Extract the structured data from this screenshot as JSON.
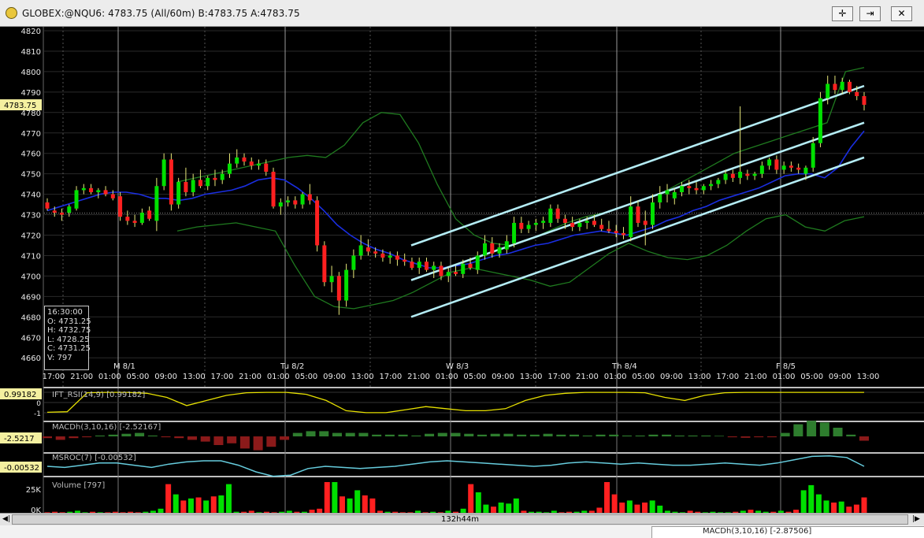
{
  "window": {
    "title": "GLOBEX:@NQU6: 4783.75 (All/60m)  B:4783.75  A:4783.75",
    "buttons": [
      {
        "name": "crosshair-button",
        "glyph": "✛"
      },
      {
        "name": "pin-button",
        "glyph": "⇥"
      },
      {
        "name": "close-button",
        "glyph": "✕"
      }
    ]
  },
  "price_axis": {
    "ticks": [
      "4820",
      "4810",
      "4800",
      "4790",
      "4780",
      "4770",
      "4760",
      "4750",
      "4740",
      "4730",
      "4720",
      "4710",
      "4700",
      "4690",
      "4680",
      "4670",
      "4660"
    ],
    "current_price_tag": "4783.75"
  },
  "time_axis": {
    "day_labels": [
      "M  8/1",
      "Tu 8/2",
      "W  8/3",
      "Th 8/4",
      "F  8/5"
    ],
    "hour_labels": [
      "17:00",
      "21:00",
      "01:00",
      "05:00",
      "09:00",
      "13:00",
      "17:00",
      "21:00",
      "01:00",
      "05:00",
      "09:00",
      "13:00",
      "17:00",
      "21:00",
      "01:00",
      "05:00",
      "09:00",
      "13:00",
      "17:00",
      "21:00",
      "01:00",
      "05:00",
      "09:00",
      "13:00",
      "17:00",
      "21:00",
      "01:00",
      "05:00",
      "09:00",
      "13:00"
    ]
  },
  "ohlc_box": {
    "time": "16:30:00",
    "open": "O: 4731.25",
    "high": "H: 4732.75",
    "low": "L: 4728.25",
    "close": "C: 4731.25",
    "vol": "V: 797"
  },
  "indicators": {
    "ift_rsi": {
      "label": "IFT_RSI(14,9)  [0.99182]",
      "tag": "0.99182",
      "ticks": [
        "1",
        "0",
        "-1"
      ],
      "color": "#e6e000"
    },
    "macdh": {
      "label": "MACDh(3,10,16)  [-2.52167]",
      "tag": "-2.5217",
      "color": "#2e8b2e"
    },
    "msroc": {
      "label": "MSROC(7)  [-0.00532]",
      "tag": "-0.00532",
      "color": "#66ccdd"
    },
    "volume": {
      "label": "Volume  [797]",
      "ticks": [
        "25K",
        "0K"
      ]
    }
  },
  "scrollbar": {
    "label": "132h44m"
  },
  "statusbar": {
    "text": "MACDh(3,10,16)  [-2.87506]"
  },
  "colors": {
    "background": "#000000",
    "up_candle": "#00e000",
    "down_candle": "#ff2020",
    "wick": "#e8e87a",
    "bollinger": "#1f7a1f",
    "moving_average": "#1a2ee0",
    "channel": "#b4ecf4"
  },
  "chart_data": {
    "type": "candlestick",
    "instrument": "@NQU6",
    "interval": "60m",
    "ylim": [
      4655,
      4822
    ],
    "candles": [
      {
        "o": 4736,
        "h": 4738,
        "l": 4732,
        "c": 4733
      },
      {
        "o": 4732,
        "h": 4734,
        "l": 4729,
        "c": 4731
      },
      {
        "o": 4731,
        "h": 4733,
        "l": 4727,
        "c": 4730
      },
      {
        "o": 4731,
        "h": 4735,
        "l": 4729,
        "c": 4734
      },
      {
        "o": 4733,
        "h": 4744,
        "l": 4732,
        "c": 4742
      },
      {
        "o": 4742,
        "h": 4745,
        "l": 4740,
        "c": 4743
      },
      {
        "o": 4743,
        "h": 4745,
        "l": 4740,
        "c": 4741
      },
      {
        "o": 4741,
        "h": 4743,
        "l": 4738,
        "c": 4742
      },
      {
        "o": 4742,
        "h": 4744,
        "l": 4739,
        "c": 4740
      },
      {
        "o": 4740,
        "h": 4742,
        "l": 4737,
        "c": 4738
      },
      {
        "o": 4739,
        "h": 4741,
        "l": 4727,
        "c": 4729
      },
      {
        "o": 4729,
        "h": 4732,
        "l": 4725,
        "c": 4727
      },
      {
        "o": 4727,
        "h": 4730,
        "l": 4724,
        "c": 4726
      },
      {
        "o": 4726,
        "h": 4733,
        "l": 4725,
        "c": 4731
      },
      {
        "o": 4732,
        "h": 4734,
        "l": 4727,
        "c": 4728
      },
      {
        "o": 4727,
        "h": 4748,
        "l": 4722,
        "c": 4744
      },
      {
        "o": 4744,
        "h": 4760,
        "l": 4742,
        "c": 4757
      },
      {
        "o": 4757,
        "h": 4760,
        "l": 4732,
        "c": 4735
      },
      {
        "o": 4735,
        "h": 4748,
        "l": 4733,
        "c": 4746
      },
      {
        "o": 4746,
        "h": 4753,
        "l": 4739,
        "c": 4741
      },
      {
        "o": 4741,
        "h": 4750,
        "l": 4739,
        "c": 4747
      },
      {
        "o": 4747,
        "h": 4752,
        "l": 4743,
        "c": 4744
      },
      {
        "o": 4744,
        "h": 4749,
        "l": 4742,
        "c": 4748
      },
      {
        "o": 4748,
        "h": 4752,
        "l": 4744,
        "c": 4747
      },
      {
        "o": 4747,
        "h": 4752,
        "l": 4745,
        "c": 4750
      },
      {
        "o": 4750,
        "h": 4760,
        "l": 4748,
        "c": 4755
      },
      {
        "o": 4755,
        "h": 4762,
        "l": 4753,
        "c": 4758
      },
      {
        "o": 4758,
        "h": 4760,
        "l": 4754,
        "c": 4756
      },
      {
        "o": 4756,
        "h": 4758,
        "l": 4752,
        "c": 4754
      },
      {
        "o": 4754,
        "h": 4757,
        "l": 4752,
        "c": 4755
      },
      {
        "o": 4755,
        "h": 4757,
        "l": 4749,
        "c": 4751
      },
      {
        "o": 4751,
        "h": 4753,
        "l": 4733,
        "c": 4734
      },
      {
        "o": 4734,
        "h": 4738,
        "l": 4730,
        "c": 4736
      },
      {
        "o": 4736,
        "h": 4739,
        "l": 4734,
        "c": 4737
      },
      {
        "o": 4737,
        "h": 4739,
        "l": 4733,
        "c": 4735
      },
      {
        "o": 4735,
        "h": 4741,
        "l": 4733,
        "c": 4740
      },
      {
        "o": 4740,
        "h": 4745,
        "l": 4735,
        "c": 4737
      },
      {
        "o": 4737,
        "h": 4739,
        "l": 4712,
        "c": 4715
      },
      {
        "o": 4715,
        "h": 4717,
        "l": 4695,
        "c": 4697
      },
      {
        "o": 4697,
        "h": 4705,
        "l": 4692,
        "c": 4700
      },
      {
        "o": 4700,
        "h": 4702,
        "l": 4681,
        "c": 4688
      },
      {
        "o": 4688,
        "h": 4706,
        "l": 4685,
        "c": 4703
      },
      {
        "o": 4703,
        "h": 4713,
        "l": 4699,
        "c": 4710
      },
      {
        "o": 4710,
        "h": 4720,
        "l": 4708,
        "c": 4715
      },
      {
        "o": 4714,
        "h": 4718,
        "l": 4710,
        "c": 4712
      },
      {
        "o": 4712,
        "h": 4714,
        "l": 4709,
        "c": 4711
      },
      {
        "o": 4711,
        "h": 4713,
        "l": 4707,
        "c": 4709
      },
      {
        "o": 4709,
        "h": 4712,
        "l": 4706,
        "c": 4710
      },
      {
        "o": 4710,
        "h": 4712,
        "l": 4705,
        "c": 4708
      },
      {
        "o": 4708,
        "h": 4711,
        "l": 4705,
        "c": 4707
      },
      {
        "o": 4707,
        "h": 4709,
        "l": 4703,
        "c": 4704
      },
      {
        "o": 4704,
        "h": 4709,
        "l": 4701,
        "c": 4707
      },
      {
        "o": 4707,
        "h": 4709,
        "l": 4702,
        "c": 4703
      },
      {
        "o": 4703,
        "h": 4707,
        "l": 4699,
        "c": 4705
      },
      {
        "o": 4705,
        "h": 4707,
        "l": 4698,
        "c": 4700
      },
      {
        "o": 4700,
        "h": 4704,
        "l": 4697,
        "c": 4702
      },
      {
        "o": 4702,
        "h": 4705,
        "l": 4700,
        "c": 4701
      },
      {
        "o": 4701,
        "h": 4708,
        "l": 4699,
        "c": 4706
      },
      {
        "o": 4706,
        "h": 4709,
        "l": 4703,
        "c": 4704
      },
      {
        "o": 4703,
        "h": 4712,
        "l": 4701,
        "c": 4710
      },
      {
        "o": 4710,
        "h": 4720,
        "l": 4708,
        "c": 4716
      },
      {
        "o": 4716,
        "h": 4719,
        "l": 4709,
        "c": 4711
      },
      {
        "o": 4711,
        "h": 4716,
        "l": 4709,
        "c": 4714
      },
      {
        "o": 4713,
        "h": 4720,
        "l": 4711,
        "c": 4717
      },
      {
        "o": 4716,
        "h": 4729,
        "l": 4714,
        "c": 4726
      },
      {
        "o": 4726,
        "h": 4729,
        "l": 4721,
        "c": 4723
      },
      {
        "o": 4723,
        "h": 4727,
        "l": 4721,
        "c": 4725
      },
      {
        "o": 4725,
        "h": 4728,
        "l": 4722,
        "c": 4726
      },
      {
        "o": 4726,
        "h": 4729,
        "l": 4723,
        "c": 4727
      },
      {
        "o": 4726,
        "h": 4735,
        "l": 4724,
        "c": 4733
      },
      {
        "o": 4733,
        "h": 4735,
        "l": 4726,
        "c": 4728
      },
      {
        "o": 4728,
        "h": 4730,
        "l": 4723,
        "c": 4726
      },
      {
        "o": 4726,
        "h": 4729,
        "l": 4722,
        "c": 4724
      },
      {
        "o": 4724,
        "h": 4728,
        "l": 4722,
        "c": 4726
      },
      {
        "o": 4726,
        "h": 4729,
        "l": 4723,
        "c": 4727
      },
      {
        "o": 4727,
        "h": 4730,
        "l": 4724,
        "c": 4725
      },
      {
        "o": 4725,
        "h": 4728,
        "l": 4722,
        "c": 4723
      },
      {
        "o": 4723,
        "h": 4727,
        "l": 4721,
        "c": 4722
      },
      {
        "o": 4722,
        "h": 4725,
        "l": 4719,
        "c": 4721
      },
      {
        "o": 4721,
        "h": 4724,
        "l": 4718,
        "c": 4720
      },
      {
        "o": 4719,
        "h": 4739,
        "l": 4717,
        "c": 4734
      },
      {
        "o": 4734,
        "h": 4737,
        "l": 4724,
        "c": 4726
      },
      {
        "o": 4727,
        "h": 4732,
        "l": 4715,
        "c": 4725
      },
      {
        "o": 4725,
        "h": 4740,
        "l": 4723,
        "c": 4736
      },
      {
        "o": 4736,
        "h": 4744,
        "l": 4733,
        "c": 4740
      },
      {
        "o": 4740,
        "h": 4745,
        "l": 4736,
        "c": 4742
      },
      {
        "o": 4738,
        "h": 4743,
        "l": 4735,
        "c": 4741
      },
      {
        "o": 4741,
        "h": 4746,
        "l": 4739,
        "c": 4744
      },
      {
        "o": 4744,
        "h": 4747,
        "l": 4740,
        "c": 4743
      },
      {
        "o": 4743,
        "h": 4746,
        "l": 4740,
        "c": 4742
      },
      {
        "o": 4742,
        "h": 4745,
        "l": 4740,
        "c": 4744
      },
      {
        "o": 4744,
        "h": 4747,
        "l": 4742,
        "c": 4745
      },
      {
        "o": 4745,
        "h": 4748,
        "l": 4743,
        "c": 4747
      },
      {
        "o": 4747,
        "h": 4752,
        "l": 4745,
        "c": 4750
      },
      {
        "o": 4750,
        "h": 4752,
        "l": 4746,
        "c": 4748
      },
      {
        "o": 4748,
        "h": 4783,
        "l": 4745,
        "c": 4751
      },
      {
        "o": 4750,
        "h": 4752,
        "l": 4747,
        "c": 4749
      },
      {
        "o": 4749,
        "h": 4751,
        "l": 4747,
        "c": 4750
      },
      {
        "o": 4750,
        "h": 4756,
        "l": 4748,
        "c": 4754
      },
      {
        "o": 4754,
        "h": 4758,
        "l": 4752,
        "c": 4757
      },
      {
        "o": 4757,
        "h": 4759,
        "l": 4750,
        "c": 4752
      },
      {
        "o": 4752,
        "h": 4756,
        "l": 4750,
        "c": 4754
      },
      {
        "o": 4754,
        "h": 4756,
        "l": 4751,
        "c": 4753
      },
      {
        "o": 4753,
        "h": 4755,
        "l": 4750,
        "c": 4752
      },
      {
        "o": 4750,
        "h": 4754,
        "l": 4747,
        "c": 4753
      },
      {
        "o": 4753,
        "h": 4768,
        "l": 4751,
        "c": 4765
      },
      {
        "o": 4765,
        "h": 4790,
        "l": 4763,
        "c": 4787
      },
      {
        "o": 4787,
        "h": 4798,
        "l": 4784,
        "c": 4794
      },
      {
        "o": 4794,
        "h": 4798,
        "l": 4789,
        "c": 4791
      },
      {
        "o": 4791,
        "h": 4797,
        "l": 4789,
        "c": 4795
      },
      {
        "o": 4795,
        "h": 4796,
        "l": 4789,
        "c": 4790
      },
      {
        "o": 4790,
        "h": 4793,
        "l": 4786,
        "c": 4788
      },
      {
        "o": 4788,
        "h": 4790,
        "l": 4781,
        "c": 4783.75
      }
    ],
    "moving_average": [
      4732,
      4734,
      4736,
      4738,
      4740,
      4741,
      4741,
      4740,
      4738,
      4738,
      4737,
      4738,
      4740,
      4741,
      4742,
      4744,
      4747,
      4748,
      4747,
      4743,
      4738,
      4732,
      4725,
      4720,
      4716,
      4713,
      4711,
      4708,
      4706,
      4704,
      4704,
      4705,
      4706,
      4708,
      4710,
      4711,
      4713,
      4715,
      4716,
      4718,
      4720,
      4721,
      4722,
      4721,
      4720,
      4722,
      4724,
      4727,
      4729,
      4732,
      4734,
      4737,
      4739,
      4741,
      4743,
      4746,
      4749,
      4750,
      4750,
      4748,
      4753,
      4763,
      4771
    ],
    "bollinger_upper": [
      4746,
      4748,
      4750,
      4752,
      4754,
      4756,
      4758,
      4759,
      4758,
      4764,
      4775,
      4780,
      4779,
      4765,
      4745,
      4728,
      4720,
      4716,
      4715,
      4718,
      4722,
      4726,
      4729,
      4731,
      4734,
      4737,
      4740,
      4745,
      4750,
      4755,
      4760,
      4763,
      4766,
      4769,
      4772,
      4775,
      4800,
      4802
    ],
    "bollinger_lower": [
      4722,
      4724,
      4725,
      4726,
      4724,
      4722,
      4705,
      4690,
      4685,
      4684,
      4686,
      4688,
      4692,
      4697,
      4702,
      4704,
      4702,
      4700,
      4698,
      4695,
      4697,
      4704,
      4711,
      4716,
      4712,
      4709,
      4708,
      4710,
      4715,
      4722,
      4728,
      4730,
      4724,
      4722,
      4727,
      4729
    ],
    "channel_lines": [
      {
        "name": "upper",
        "from": [
          "W 8/3 prior 21:00",
          4715
        ],
        "to": [
          "F 8/5 13:00",
          4793
        ]
      },
      {
        "name": "middle",
        "from": [
          "W 8/3 prior 21:00",
          4698
        ],
        "to": [
          "F 8/5 13:00",
          4775
        ]
      },
      {
        "name": "lower",
        "from": [
          "W 8/3 prior 21:00",
          4680
        ],
        "to": [
          "F 8/5 13:00",
          4758
        ]
      }
    ],
    "ift_rsi": [
      -0.95,
      -0.9,
      0.95,
      0.99,
      0.99,
      0.9,
      0.5,
      -0.3,
      0.2,
      0.7,
      0.95,
      0.99,
      0.99,
      0.8,
      0.2,
      -0.8,
      -0.99,
      -0.99,
      -0.7,
      -0.4,
      -0.6,
      -0.8,
      -0.8,
      -0.6,
      0.2,
      0.7,
      0.9,
      0.99,
      0.99,
      0.99,
      0.95,
      0.5,
      0.2,
      0.7,
      0.95,
      0.99,
      0.99,
      0.99,
      0.99,
      0.99,
      0.99,
      0.99
    ],
    "macdh": [
      -1,
      -2,
      -1,
      -0.5,
      0.5,
      1,
      1.5,
      2,
      0.5,
      -0.5,
      -1,
      -2,
      -3,
      -5,
      -4,
      -7,
      -8,
      -6,
      -2,
      2,
      3,
      3,
      2,
      2,
      2,
      1,
      1,
      1,
      0.5,
      1.5,
      2,
      2,
      1.5,
      1,
      1.5,
      1.5,
      1,
      1,
      1.5,
      1,
      1,
      0.5,
      1,
      1,
      0.5,
      0.5,
      1,
      1,
      0.5,
      0.5,
      0.5,
      0.3,
      -0.5,
      -0.8,
      -0.5,
      -0.5,
      2,
      7,
      9,
      8,
      5,
      1,
      -2.5
    ],
    "msroc": [
      0,
      -0.1,
      0.1,
      0.3,
      0.3,
      0.1,
      -0.1,
      0.2,
      0.4,
      0.5,
      0.5,
      0.1,
      -0.5,
      -0.9,
      -0.8,
      -0.2,
      0,
      -0.1,
      -0.2,
      -0.1,
      0,
      0.2,
      0.4,
      0.5,
      0.4,
      0.3,
      0.2,
      0.1,
      0,
      0.1,
      0.3,
      0.4,
      0.3,
      0.2,
      0.3,
      0.2,
      0.1,
      0.1,
      0.2,
      0.3,
      0.2,
      0.1,
      0.3,
      0.6,
      0.9,
      0.95,
      0.8,
      0
    ],
    "volume": [
      0.5,
      1,
      0.5,
      1,
      2,
      0.5,
      1,
      0.5,
      0.5,
      1,
      0.5,
      1,
      0.5,
      1,
      2,
      4,
      28,
      18,
      12,
      14,
      15,
      12,
      16,
      17,
      28,
      1,
      1,
      2,
      0.5,
      1,
      0.5,
      1,
      2,
      1,
      1,
      3,
      4,
      30,
      30,
      16,
      14,
      22,
      17,
      14,
      2,
      1,
      1,
      0.5,
      0.5,
      2,
      0.5,
      1,
      0.5,
      2,
      1,
      4,
      28,
      20,
      8,
      6,
      10,
      9,
      14,
      2,
      1,
      1,
      0.5,
      2,
      0.5,
      1,
      1,
      2,
      2,
      5,
      30,
      18,
      10,
      12,
      8,
      10,
      12,
      7,
      2,
      1,
      0.5,
      2,
      1,
      0.5,
      1,
      0.5,
      0.5,
      1,
      2,
      3,
      2,
      1,
      1,
      2,
      1,
      3,
      22,
      27,
      18,
      12,
      10,
      11,
      6,
      8,
      15
    ]
  }
}
